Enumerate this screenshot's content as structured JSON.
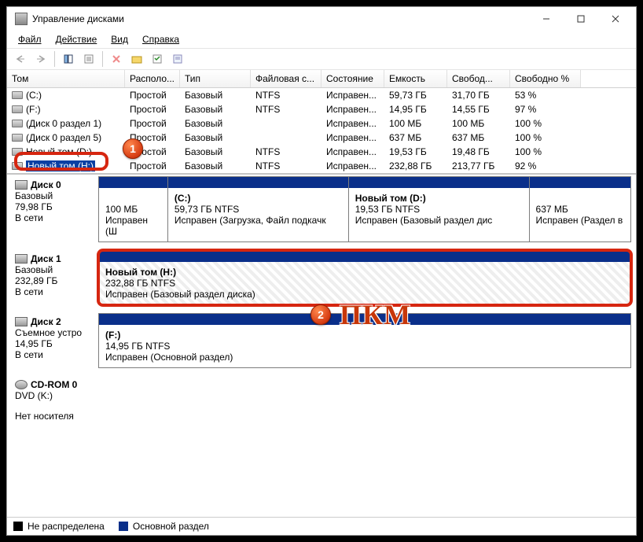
{
  "window": {
    "title": "Управление дисками"
  },
  "menu": {
    "file": "Файл",
    "action": "Действие",
    "view": "Вид",
    "help": "Справка"
  },
  "columns": [
    "Том",
    "Располо...",
    "Тип",
    "Файловая с...",
    "Состояние",
    "Емкость",
    "Свобод...",
    "Свободно %"
  ],
  "volumes": [
    {
      "name": "(C:)",
      "layout": "Простой",
      "type": "Базовый",
      "fs": "NTFS",
      "status": "Исправен...",
      "cap": "59,73 ГБ",
      "free": "31,70 ГБ",
      "pct": "53 %"
    },
    {
      "name": "(F:)",
      "layout": "Простой",
      "type": "Базовый",
      "fs": "NTFS",
      "status": "Исправен...",
      "cap": "14,95 ГБ",
      "free": "14,55 ГБ",
      "pct": "97 %"
    },
    {
      "name": "(Диск 0 раздел 1)",
      "layout": "Простой",
      "type": "Базовый",
      "fs": "",
      "status": "Исправен...",
      "cap": "100 МБ",
      "free": "100 МБ",
      "pct": "100 %"
    },
    {
      "name": "(Диск 0 раздел 5)",
      "layout": "Простой",
      "type": "Базовый",
      "fs": "",
      "status": "Исправен...",
      "cap": "637 МБ",
      "free": "637 МБ",
      "pct": "100 %"
    },
    {
      "name": "Новый том (D:)",
      "layout": "Простой",
      "type": "Базовый",
      "fs": "NTFS",
      "status": "Исправен...",
      "cap": "19,53 ГБ",
      "free": "19,48 ГБ",
      "pct": "100 %"
    },
    {
      "name": "Новый том (H:)",
      "layout": "Простой",
      "type": "Базовый",
      "fs": "NTFS",
      "status": "Исправен...",
      "cap": "232,88 ГБ",
      "free": "213,77 ГБ",
      "pct": "92 %",
      "selected": true
    }
  ],
  "disks": {
    "d0": {
      "name": "Диск 0",
      "type": "Базовый",
      "size": "79,98 ГБ",
      "status": "В сети",
      "p0": {
        "title": "",
        "l1": "100 МБ",
        "l2": "Исправен (Ш"
      },
      "p1": {
        "title": "(C:)",
        "l1": "59,73 ГБ NTFS",
        "l2": "Исправен (Загрузка, Файл подкачк"
      },
      "p2": {
        "title": "Новый том  (D:)",
        "l1": "19,53 ГБ NTFS",
        "l2": "Исправен (Базовый раздел дис"
      },
      "p3": {
        "title": "",
        "l1": "637 МБ",
        "l2": "Исправен (Раздел в"
      }
    },
    "d1": {
      "name": "Диск 1",
      "type": "Базовый",
      "size": "232,89 ГБ",
      "status": "В сети",
      "p0": {
        "title": "Новый том  (H:)",
        "l1": "232,88 ГБ NTFS",
        "l2": "Исправен (Базовый раздел диска)"
      }
    },
    "d2": {
      "name": "Диск 2",
      "type": "Съемное устро",
      "size": "14,95 ГБ",
      "status": "В сети",
      "p0": {
        "title": "(F:)",
        "l1": "14,95 ГБ NTFS",
        "l2": "Исправен (Основной раздел)"
      }
    },
    "cd": {
      "name": "CD-ROM 0",
      "type": "DVD (K:)",
      "status": "Нет носителя"
    }
  },
  "legend": {
    "unalloc": "Не распределена",
    "primary": "Основной раздел"
  },
  "annotation": {
    "pkm": "ПКМ",
    "m1": "1",
    "m2": "2"
  }
}
